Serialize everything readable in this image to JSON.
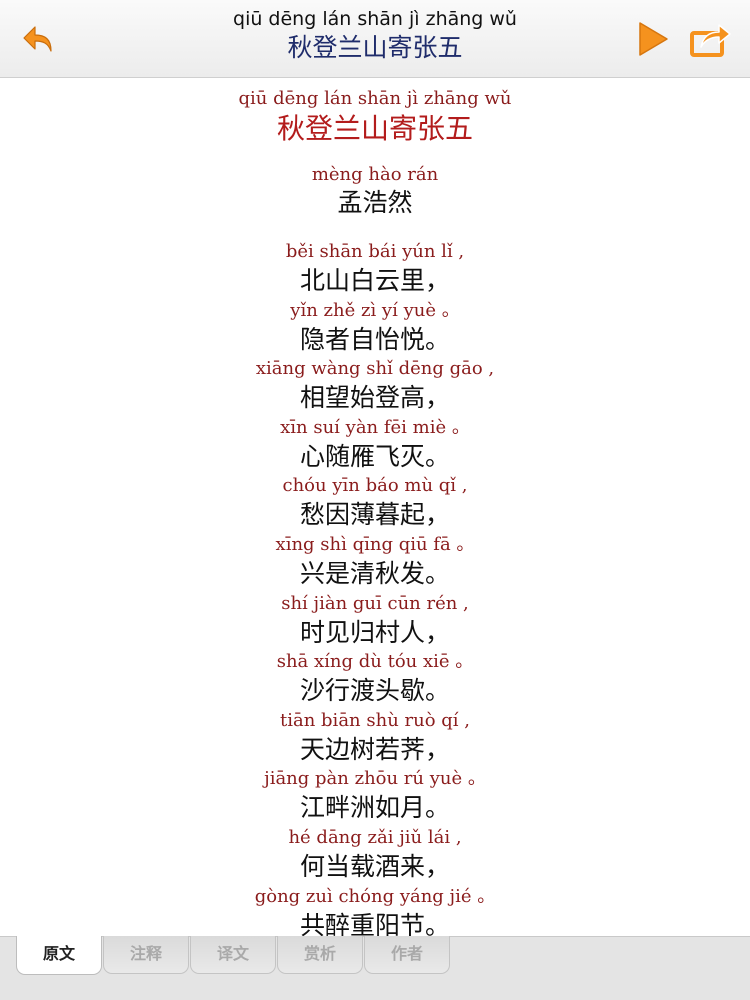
{
  "nav": {
    "pinyin": "qiū dēng lán shān jì zhāng wǔ",
    "title": "秋登兰山寄张五"
  },
  "poem": {
    "title_pinyin": "qiū dēng lán shān jì zhāng wǔ",
    "title": "秋登兰山寄张五",
    "author_pinyin": "mèng hào rán",
    "author": "孟浩然",
    "lines": [
      {
        "py": "běi shān bái yún lǐ ,",
        "zh": "北山白云里，"
      },
      {
        "py": "yǐn zhě zì yí yuè 。",
        "zh": "隐者自怡悦。"
      },
      {
        "py": "xiāng wàng shǐ dēng gāo ,",
        "zh": "相望始登高，"
      },
      {
        "py": "xīn suí yàn fēi miè 。",
        "zh": "心随雁飞灭。"
      },
      {
        "py": "chóu yīn báo mù qǐ ,",
        "zh": "愁因薄暮起，"
      },
      {
        "py": "xīng shì qīng qiū fā 。",
        "zh": "兴是清秋发。"
      },
      {
        "py": "shí jiàn guī cūn rén ,",
        "zh": "时见归村人，"
      },
      {
        "py": "shā xíng dù tóu xiē 。",
        "zh": "沙行渡头歇。"
      },
      {
        "py": "tiān biān shù ruò qí ,",
        "zh": "天边树若荠，"
      },
      {
        "py": "jiāng pàn zhōu rú yuè 。",
        "zh": "江畔洲如月。"
      },
      {
        "py": "hé dāng zǎi jiǔ lái ,",
        "zh": "何当载酒来，"
      },
      {
        "py": "gòng zuì chóng yáng jié 。",
        "zh": "共醉重阳节。"
      }
    ]
  },
  "tabs": [
    {
      "label": "原文",
      "active": true
    },
    {
      "label": "注释",
      "active": false
    },
    {
      "label": "译文",
      "active": false
    },
    {
      "label": "赏析",
      "active": false
    },
    {
      "label": "作者",
      "active": false
    }
  ],
  "colors": {
    "accent": "#f5921e",
    "pinyin": "#8a1c1c",
    "title": "#b31c1c",
    "nav_title": "#1f2c6b"
  },
  "icons": {
    "back": "back-arrow-icon",
    "play": "play-icon",
    "share": "share-icon"
  }
}
